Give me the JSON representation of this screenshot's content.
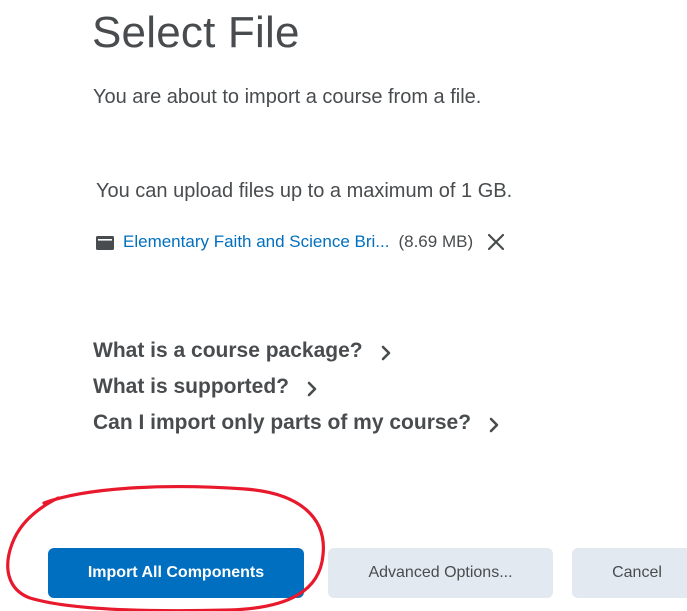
{
  "title": "Select File",
  "intro": "You are about to import a course from a file.",
  "upload_limit": "You can upload files up to a maximum of 1 GB.",
  "file": {
    "name": "Elementary Faith and Science Bri...",
    "size": "(8.69 MB)",
    "icon": "file-icon",
    "remove_icon": "close-icon"
  },
  "help": {
    "items": [
      {
        "label": "What is a course package?"
      },
      {
        "label": "What is supported?"
      },
      {
        "label": "Can I import only parts of my course?"
      }
    ]
  },
  "buttons": {
    "primary": "Import All Components",
    "advanced": "Advanced Options...",
    "cancel": "Cancel"
  },
  "colors": {
    "primary": "#006fbf",
    "secondary_bg": "#e3e9f1",
    "text": "#494c4e",
    "annotation": "#e8192c"
  }
}
